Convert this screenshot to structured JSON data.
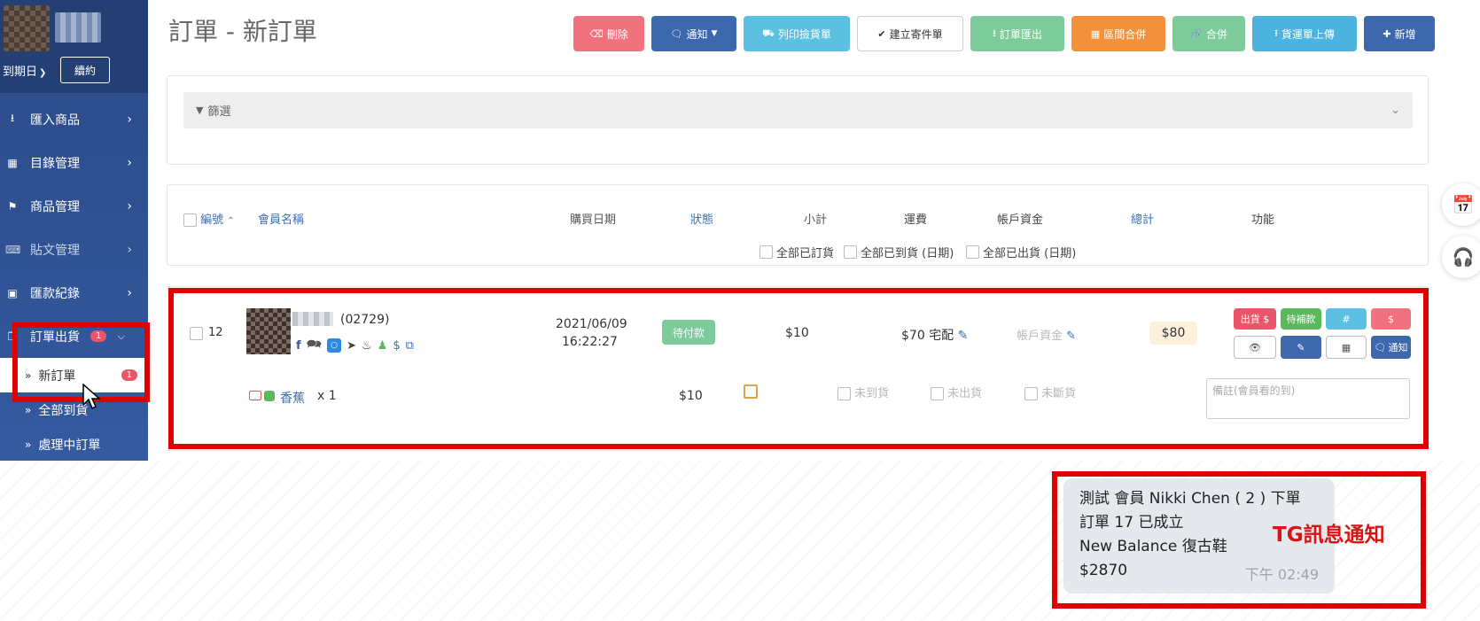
{
  "sidebar": {
    "expire_label": "到期日",
    "renew_label": "續約",
    "items": [
      {
        "label": "匯入商品"
      },
      {
        "label": "目錄管理"
      },
      {
        "label": "商品管理"
      },
      {
        "label": "貼文管理"
      },
      {
        "label": "匯款紀錄"
      },
      {
        "label": "訂單出貨",
        "badge": "1"
      }
    ],
    "subitems": [
      {
        "label": "新訂單",
        "badge": "1"
      },
      {
        "label": "全部到貨"
      },
      {
        "label": "處理中訂單"
      }
    ]
  },
  "page": {
    "title": "訂單 - 新訂單"
  },
  "toolbar": {
    "buttons": [
      {
        "label": "刪除",
        "color": "#f0727f"
      },
      {
        "label": "通知",
        "color": "#3d68ad"
      },
      {
        "label": "列印撿貨單",
        "color": "#5cc0e3"
      },
      {
        "label": "建立寄件單",
        "color": "#ffffff"
      },
      {
        "label": "訂單匯出",
        "color": "#7dcb9a"
      },
      {
        "label": "區間合併",
        "color": "#f2913b"
      },
      {
        "label": "合併",
        "color": "#7dcb9a"
      },
      {
        "label": "貨運單上傳",
        "color": "#4bb3de"
      },
      {
        "label": "新增",
        "color": "#3d68ad"
      }
    ]
  },
  "filter": {
    "label": "篩選"
  },
  "table": {
    "headers": {
      "number": "編號",
      "member": "會員名稱",
      "date": "購買日期",
      "status": "狀態",
      "subtotal": "小計",
      "shipping": "運費",
      "account": "帳戶資金",
      "total": "總計",
      "actions": "功能"
    },
    "bulk": {
      "ordered": "全部已訂貨",
      "arrived": "全部已到貨 (日期)",
      "shipped": "全部已出貨 (日期)"
    }
  },
  "order": {
    "number": "12",
    "member_code": "(02729)",
    "date": "2021/06/09",
    "time": "16:22:27",
    "status": "待付款",
    "subtotal": "$10",
    "shipping": "$70 宅配",
    "account": "帳戶資金",
    "total": "$80",
    "actions": {
      "ship": "出貨 $",
      "pending": "待補款",
      "hash": "#",
      "dollar": "$",
      "notify": "通知"
    },
    "item": {
      "name": "香蕉",
      "qty": "x 1",
      "price": "$10",
      "not_arrived": "未到貨",
      "not_shipped": "未出貨",
      "not_out": "未斷貨",
      "note_placeholder": "備註(會員看的到)"
    }
  },
  "tg": {
    "line1": "測試 會員 Nikki Chen ( 2 ) 下單",
    "line2": "訂單 17 已成立",
    "line3": "New Balance 復古鞋",
    "line4": "$2870",
    "time": "下午 02:49",
    "label": "TG訊息通知"
  },
  "colors": {
    "accent_red": "#e00000",
    "sidebar": "#2b4a86",
    "link": "#3a6fb5"
  }
}
